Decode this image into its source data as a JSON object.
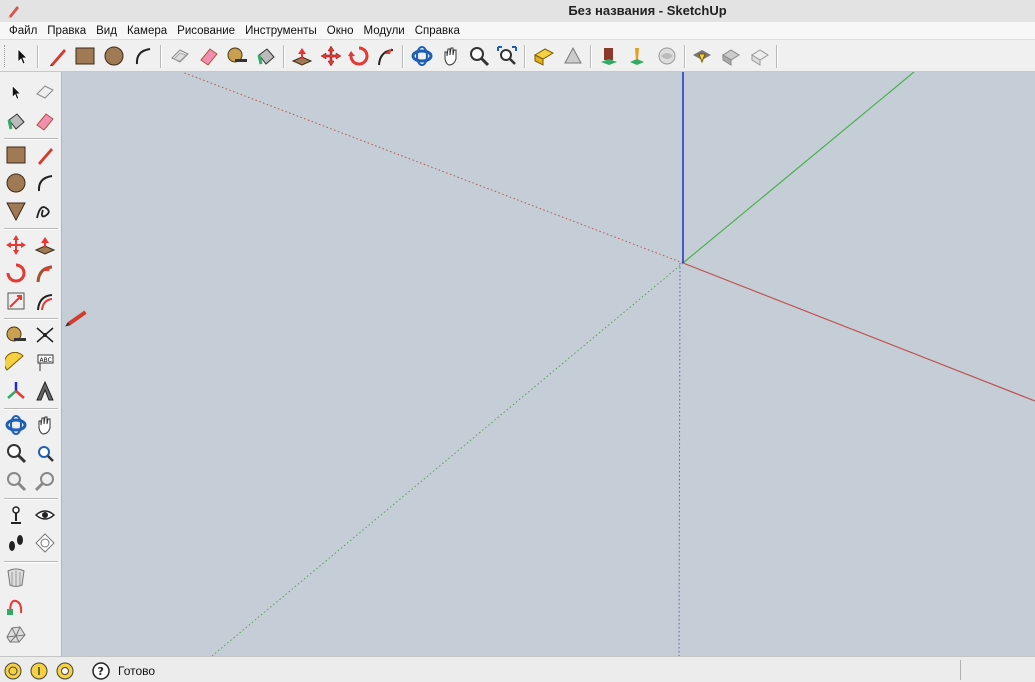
{
  "window": {
    "title": "Без названия - SketchUp"
  },
  "menu": [
    "Файл",
    "Правка",
    "Вид",
    "Камера",
    "Рисование",
    "Инструменты",
    "Окно",
    "Модули",
    "Справка"
  ],
  "status": {
    "text": "Готово"
  },
  "colors": {
    "viewport_bg": "#c5ced6",
    "axis_red": "#c0504d",
    "axis_green": "#4caf50",
    "axis_blue": "#1f2bd1"
  },
  "top_toolbar_icons": [
    "select-icon",
    "line-icon",
    "rectangle-icon",
    "circle-icon",
    "arc-icon",
    "make-component-icon",
    "eraser-icon",
    "tape-measure-icon",
    "paint-bucket-icon",
    "push-pull-icon",
    "move-icon",
    "rotate-icon",
    "follow-me-icon",
    "orbit-icon",
    "pan-icon",
    "zoom-icon",
    "zoom-extents-icon",
    "previous-view-icon",
    "next-view-icon",
    "3d-warehouse-icon",
    "extension-warehouse-icon",
    "building-icon",
    "share-model-icon",
    "layout-icon",
    "style-builder-icon"
  ],
  "left_toolbar_icons": [
    "select-icon",
    "make-component-icon",
    "paint-bucket-icon",
    "eraser-icon",
    "rectangle-icon",
    "line-icon",
    "circle-icon",
    "arc-icon",
    "polygon-icon",
    "freehand-icon",
    "move-icon",
    "push-pull-icon",
    "rotate-icon",
    "follow-me-icon",
    "scale-icon",
    "offset-icon",
    "tape-measure-icon",
    "dimension-icon",
    "protractor-icon",
    "text-icon",
    "axes-icon",
    "3d-text-icon",
    "orbit-icon",
    "pan-icon",
    "zoom-icon",
    "zoom-window-icon",
    "zoom-extents-icon",
    "previous-view-icon",
    "position-camera-icon",
    "look-around-icon",
    "walk-icon",
    "section-plane-icon",
    "sandbox-icon",
    "add-location-icon",
    "terrain-icon"
  ]
}
